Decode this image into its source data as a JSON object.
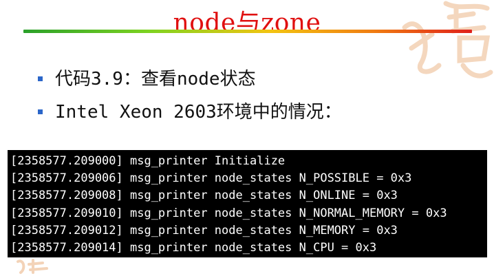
{
  "slide": {
    "title": "node与zone",
    "bullets": [
      "代码3.9：查看node状态",
      "Intel Xeon 2603环境中的情况："
    ]
  },
  "terminal": {
    "lines": [
      "[2358577.209000] msg_printer Initialize",
      "[2358577.209006] msg_printer node_states N_POSSIBLE = 0x3",
      "[2358577.209008] msg_printer node_states N_ONLINE = 0x3",
      "[2358577.209010] msg_printer node_states N_NORMAL_MEMORY = 0x3",
      "[2358577.209012] msg_printer node_states N_MEMORY = 0x3",
      "[2358577.209014] msg_printer node_states N_CPU = 0x3"
    ]
  },
  "colors": {
    "title": "#e01010",
    "bullet": "#2b66c9",
    "terminal_bg": "#000000",
    "terminal_text": "#ffffff"
  },
  "icons": [
    "bullet-square-icon",
    "calligraphy-watermark-icon"
  ]
}
